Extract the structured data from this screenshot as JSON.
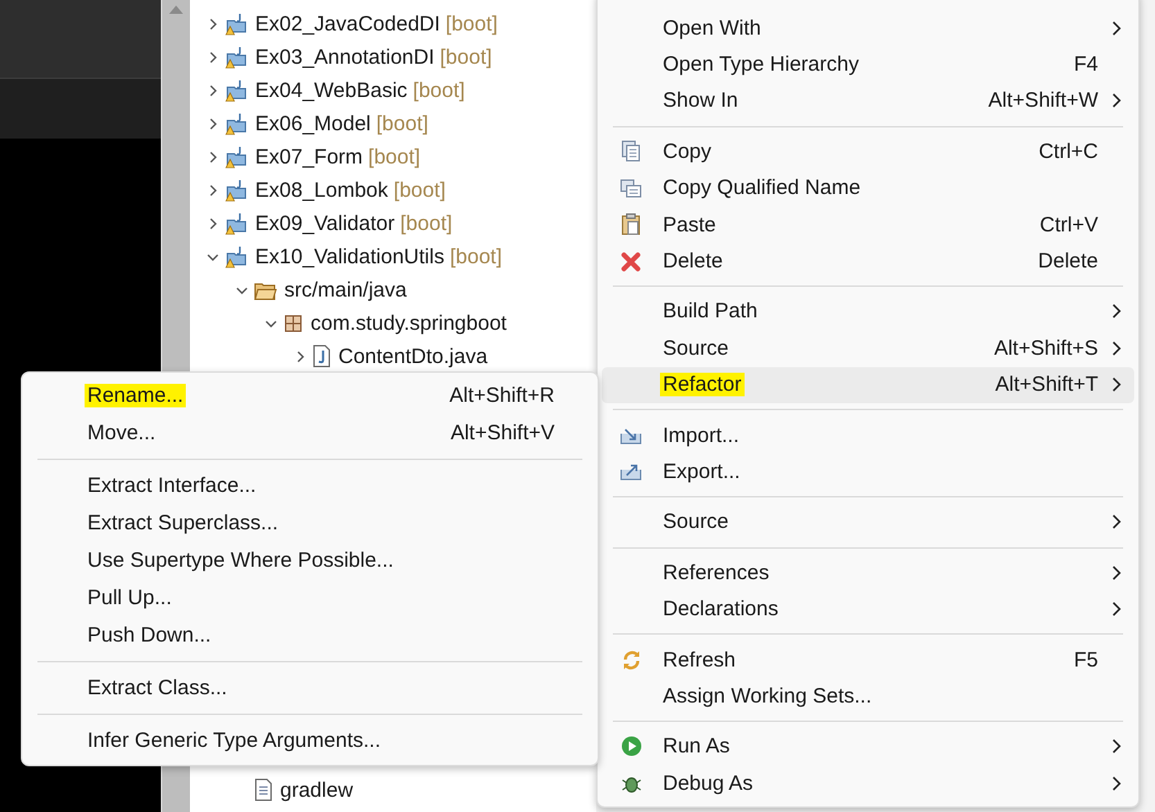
{
  "tree": [
    {
      "label": "Ex02_JavaCodedDI",
      "tag": "[boot]",
      "kind": "project",
      "expanded": false
    },
    {
      "label": "Ex03_AnnotationDI",
      "tag": "[boot]",
      "kind": "project",
      "expanded": false
    },
    {
      "label": "Ex04_WebBasic",
      "tag": "[boot]",
      "kind": "project",
      "expanded": false
    },
    {
      "label": "Ex06_Model",
      "tag": "[boot]",
      "kind": "project",
      "expanded": false
    },
    {
      "label": "Ex07_Form",
      "tag": "[boot]",
      "kind": "project",
      "expanded": false
    },
    {
      "label": "Ex08_Lombok",
      "tag": "[boot]",
      "kind": "project",
      "expanded": false
    },
    {
      "label": "Ex09_Validator",
      "tag": "[boot]",
      "kind": "project",
      "expanded": false
    },
    {
      "label": "Ex10_ValidationUtils",
      "tag": "[boot]",
      "kind": "project",
      "expanded": true,
      "children": [
        {
          "label": "src/main/java",
          "kind": "source-folder",
          "expanded": true,
          "children": [
            {
              "label": "com.study.springboot",
              "kind": "package",
              "expanded": true,
              "children": [
                {
                  "label": "ContentDto.java",
                  "kind": "java-file",
                  "expanded": false
                }
              ]
            }
          ]
        },
        {
          "label": "gradlew",
          "kind": "file"
        }
      ]
    }
  ],
  "context_menu": [
    {
      "kind": "item",
      "label": "Open With",
      "submenu": true,
      "selected": false,
      "marked": false
    },
    {
      "kind": "item",
      "label": "Open Type Hierarchy",
      "shortcut": "F4",
      "selected": false,
      "marked": false
    },
    {
      "kind": "item",
      "label": "Show In",
      "shortcut": "Alt+Shift+W",
      "submenu": true,
      "selected": false,
      "marked": false
    },
    {
      "kind": "separator"
    },
    {
      "kind": "item",
      "label": "Copy",
      "shortcut": "Ctrl+C",
      "selected": false,
      "marked": false
    },
    {
      "kind": "item",
      "label": "Copy Qualified Name",
      "selected": false,
      "marked": false
    },
    {
      "kind": "item",
      "label": "Paste",
      "shortcut": "Ctrl+V",
      "selected": false,
      "marked": false
    },
    {
      "kind": "item",
      "label": "Delete",
      "shortcut": "Delete",
      "selected": false,
      "marked": false
    },
    {
      "kind": "separator"
    },
    {
      "kind": "item",
      "label": "Build Path",
      "submenu": true,
      "selected": false,
      "marked": false
    },
    {
      "kind": "item",
      "label": "Source",
      "shortcut": "Alt+Shift+S",
      "submenu": true,
      "selected": false,
      "marked": false
    },
    {
      "kind": "item",
      "label": "Refactor",
      "shortcut": "Alt+Shift+T",
      "submenu": true,
      "selected": true,
      "marked": true
    },
    {
      "kind": "separator"
    },
    {
      "kind": "item",
      "label": "Import...",
      "selected": false,
      "marked": false
    },
    {
      "kind": "item",
      "label": "Export...",
      "selected": false,
      "marked": false
    },
    {
      "kind": "separator"
    },
    {
      "kind": "item",
      "label": "Source",
      "submenu": true,
      "selected": false,
      "marked": false
    },
    {
      "kind": "separator"
    },
    {
      "kind": "item",
      "label": "References",
      "submenu": true,
      "selected": false,
      "marked": false
    },
    {
      "kind": "item",
      "label": "Declarations",
      "submenu": true,
      "selected": false,
      "marked": false
    },
    {
      "kind": "separator"
    },
    {
      "kind": "item",
      "label": "Refresh",
      "shortcut": "F5",
      "selected": false,
      "marked": false
    },
    {
      "kind": "item",
      "label": "Assign Working Sets...",
      "selected": false,
      "marked": false
    },
    {
      "kind": "separator"
    },
    {
      "kind": "item",
      "label": "Run As",
      "submenu": true,
      "selected": false,
      "marked": false
    },
    {
      "kind": "item",
      "label": "Debug As",
      "submenu": true,
      "selected": false,
      "marked": false
    }
  ],
  "refactor_submenu": [
    {
      "kind": "item",
      "label": "Rename...",
      "shortcut": "Alt+Shift+R",
      "selected": false,
      "marked": true
    },
    {
      "kind": "item",
      "label": "Move...",
      "shortcut": "Alt+Shift+V",
      "selected": false,
      "marked": false
    },
    {
      "kind": "separator"
    },
    {
      "kind": "item",
      "label": "Extract Interface...",
      "selected": false,
      "marked": false
    },
    {
      "kind": "item",
      "label": "Extract Superclass...",
      "selected": false,
      "marked": false
    },
    {
      "kind": "item",
      "label": "Use Supertype Where Possible...",
      "selected": false,
      "marked": false
    },
    {
      "kind": "item",
      "label": "Pull Up...",
      "selected": false,
      "marked": false
    },
    {
      "kind": "item",
      "label": "Push Down...",
      "selected": false,
      "marked": false
    },
    {
      "kind": "separator"
    },
    {
      "kind": "item",
      "label": "Extract Class...",
      "selected": false,
      "marked": false
    },
    {
      "kind": "separator"
    },
    {
      "kind": "item",
      "label": "Infer Generic Type Arguments...",
      "selected": false,
      "marked": false
    }
  ]
}
